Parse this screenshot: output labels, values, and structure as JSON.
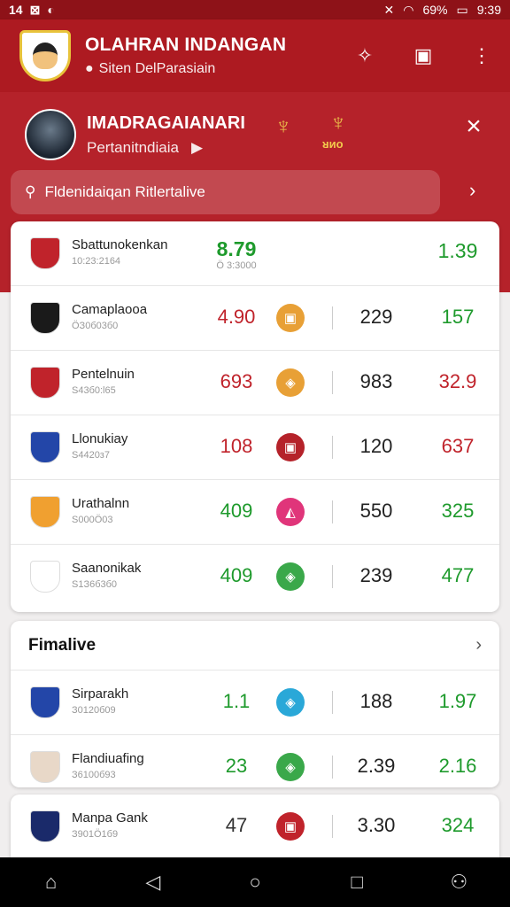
{
  "status": {
    "left": [
      "14",
      "⊠",
      "◐"
    ],
    "battery": "69%",
    "time": "9:39"
  },
  "appbar": {
    "title": "OLAHRAN INDANGAN",
    "subtitle": "Siten DelParasiain"
  },
  "profile": {
    "name": "IMADRAGAIANARI",
    "subtitle": "Pertanitndiaia",
    "emblem_text": "ᴚᴎᴏ"
  },
  "search": {
    "placeholder": "Fldenidaiqan Ritlertalive"
  },
  "card1": {
    "rows": [
      {
        "name": "Sbattunokenkan",
        "sub": "10:23:2164",
        "v1": "8.79",
        "v1_sub": "Ӧ 3:3000",
        "v2": "",
        "v3": "1.39",
        "v1_color": "#1e9a2c",
        "v3_color": "#1e9a2c",
        "logo_color": "#c0232b",
        "badge_color": "",
        "badge_icon": ""
      },
      {
        "name": "Camaplaooa",
        "sub": "ӦЗ0б03б0",
        "v1": "4.90",
        "v2": "229",
        "v3": "157",
        "v1_color": "#c0232b",
        "v3_color": "#1e9a2c",
        "logo_color": "#1a1a1a",
        "badge_color": "#e8a036",
        "badge_icon": "▣"
      },
      {
        "name": "Pentelnuin",
        "sub": "S43б0:l65",
        "v1": "693",
        "v2": "983",
        "v3": "32.9",
        "v1_color": "#c0232b",
        "v3_color": "#c0232b",
        "logo_color": "#c0232b",
        "badge_color": "#e8a036",
        "badge_icon": "◈"
      },
      {
        "name": "Llonukiay",
        "sub": "S4420з7",
        "v1": "108",
        "v2": "120",
        "v3": "637",
        "v1_color": "#c0232b",
        "v3_color": "#c0232b",
        "logo_color": "#2346a8",
        "badge_color": "#b5222a",
        "badge_icon": "▣"
      },
      {
        "name": "Urathalnn",
        "sub": "S000Ӧ03",
        "v1": "409",
        "v2": "550",
        "v3": "325",
        "v1_color": "#1e9a2c",
        "v3_color": "#1e9a2c",
        "logo_color": "#f0a030",
        "badge_color": "#e0357a",
        "badge_icon": "◭"
      },
      {
        "name": "Saanonikak",
        "sub": "S1З6б3б0",
        "v1": "409",
        "v2": "239",
        "v3": "477",
        "v1_color": "#1e9a2c",
        "v3_color": "#1e9a2c",
        "logo_color": "#ffffff",
        "badge_color": "#3aa84a",
        "badge_icon": "◈"
      }
    ]
  },
  "card2": {
    "title": "Fimalive",
    "rows": [
      {
        "name": "Sirparakh",
        "sub": "З0120б09",
        "v1": "1.1",
        "v2": "188",
        "v3": "1.97",
        "v1_color": "#1e9a2c",
        "v3_color": "#1e9a2c",
        "logo_color": "#2346a8",
        "badge_color": "#2aa8d8",
        "badge_icon": "◈"
      },
      {
        "name": "Flandiuafing",
        "sub": "З6100б93",
        "v1": "23",
        "v2": "2.39",
        "v3": "2.16",
        "v1_color": "#1e9a2c",
        "v3_color": "#1e9a2c",
        "logo_color": "#e8d8c8",
        "badge_color": "#3aa84a",
        "badge_icon": "◈"
      }
    ]
  },
  "card3": {
    "rows": [
      {
        "name": "Manpa Gank",
        "sub": "З901Ӧ1б9",
        "v1": "47",
        "v2": "3.30",
        "v3": "324",
        "v1_color": "#333333",
        "v3_color": "#1e9a2c",
        "logo_color": "#1a2a6a",
        "badge_color": "#c0232b",
        "badge_icon": "▣"
      }
    ]
  }
}
